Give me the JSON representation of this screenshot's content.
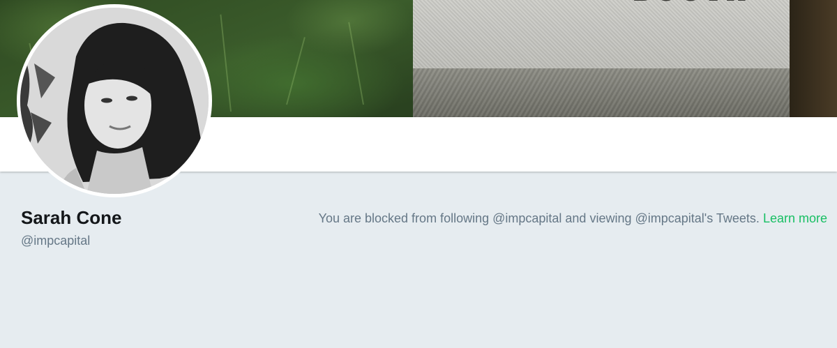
{
  "banner": {
    "stone_text": "BOOTH"
  },
  "profile": {
    "name": "Sarah Cone",
    "handle": "@impcapital"
  },
  "notice": {
    "message": "You are blocked from following @impcapital and viewing @impcapital's Tweets.",
    "link": "Learn more",
    "link_color": "#17bf63"
  },
  "colors": {
    "background": "#e6ecf0",
    "secondary_text": "#657786",
    "primary_text": "#14171a"
  }
}
